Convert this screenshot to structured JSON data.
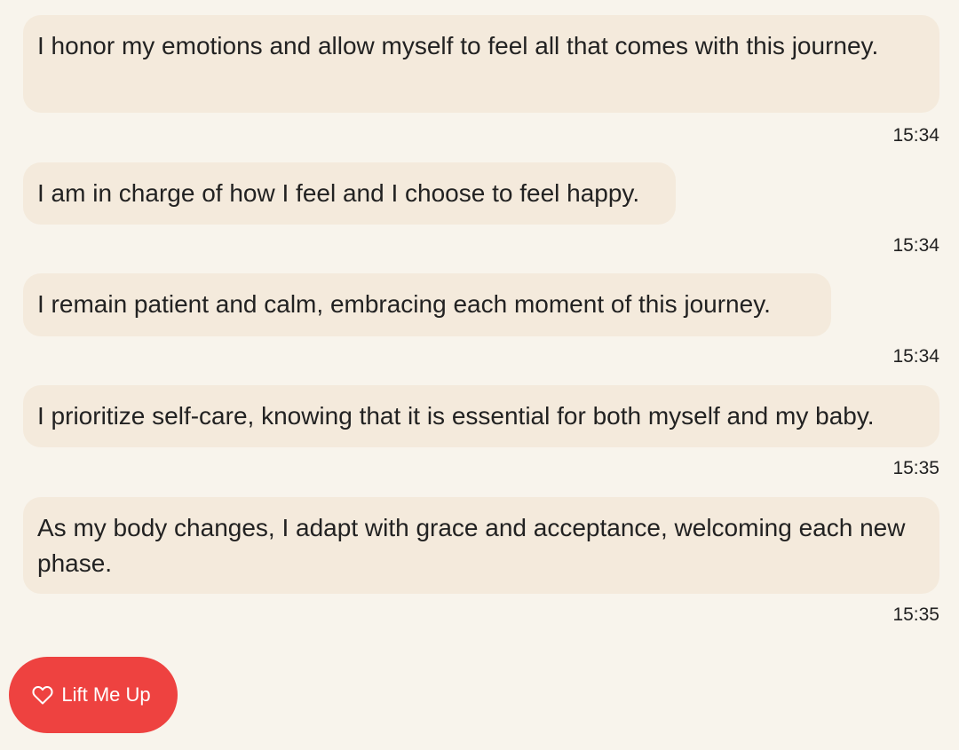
{
  "messages": [
    {
      "text": "I honor my emotions and allow myself to feel all that comes with this journey.",
      "time": "15:34"
    },
    {
      "text": "I am in charge of how I feel and I choose to feel happy.",
      "time": "15:34"
    },
    {
      "text": "I remain patient and calm, embracing each moment of this journey.",
      "time": "15:34"
    },
    {
      "text": "I prioritize self-care, knowing that it is essential for both myself and my baby.",
      "time": "15:35"
    },
    {
      "text": "As my body changes, I adapt with grace and acceptance, welcoming each new phase.",
      "time": "15:35"
    }
  ],
  "lift_button": {
    "label": "Lift Me Up",
    "icon": "heart-outline-icon",
    "color": "#ee4240"
  },
  "colors": {
    "background": "#f8f4ec",
    "bubble": "#f4eadc",
    "text": "#222222"
  }
}
